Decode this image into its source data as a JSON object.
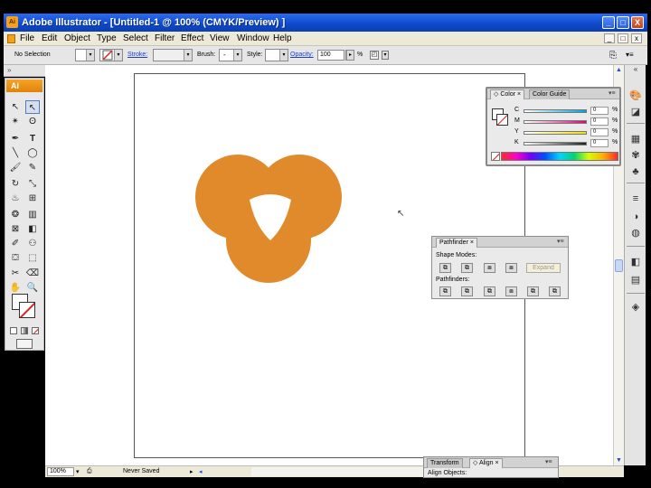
{
  "window": {
    "app_badge": "Ai",
    "title": "Adobe Illustrator - [Untitled-1 @ 100% (CMYK/Preview) ]",
    "min": "_",
    "max": "□",
    "close": "X"
  },
  "menu": {
    "items": [
      "File",
      "Edit",
      "Object",
      "Type",
      "Select",
      "Filter",
      "Effect",
      "View",
      "Window",
      "Help"
    ],
    "mdi_min": "_",
    "mdi_restore": "□",
    "mdi_close": "x"
  },
  "control_bar": {
    "selection": "No Selection",
    "stroke_label": "Stroke:",
    "brush_label": "Brush:",
    "style_label": "Style:",
    "opacity_label": "Opacity:",
    "opacity_value": "100",
    "opacity_unit": "%"
  },
  "tools": {
    "logo": "Ai"
  },
  "color_panel": {
    "tabs": [
      "Color",
      "Color Guide"
    ],
    "channels": [
      {
        "name": "C",
        "value": "0",
        "unit": "%",
        "color": "#00a0e0"
      },
      {
        "name": "M",
        "value": "0",
        "unit": "%",
        "color": "#e0007a"
      },
      {
        "name": "Y",
        "value": "0",
        "unit": "%",
        "color": "#f2e000"
      },
      {
        "name": "K",
        "value": "0",
        "unit": "%",
        "color": "#202020"
      }
    ]
  },
  "pathfinder_panel": {
    "tab": "Pathfinder",
    "shape_modes_label": "Shape Modes:",
    "expand_label": "Expand",
    "pathfinders_label": "Pathfinders:"
  },
  "bottom_panel": {
    "tabs": [
      "Transform",
      "Align"
    ],
    "align_objects_label": "Align Objects:"
  },
  "status_bar": {
    "zoom": "100%",
    "status": "Never Saved"
  },
  "artwork": {
    "fill_color": "#e08a2b"
  }
}
